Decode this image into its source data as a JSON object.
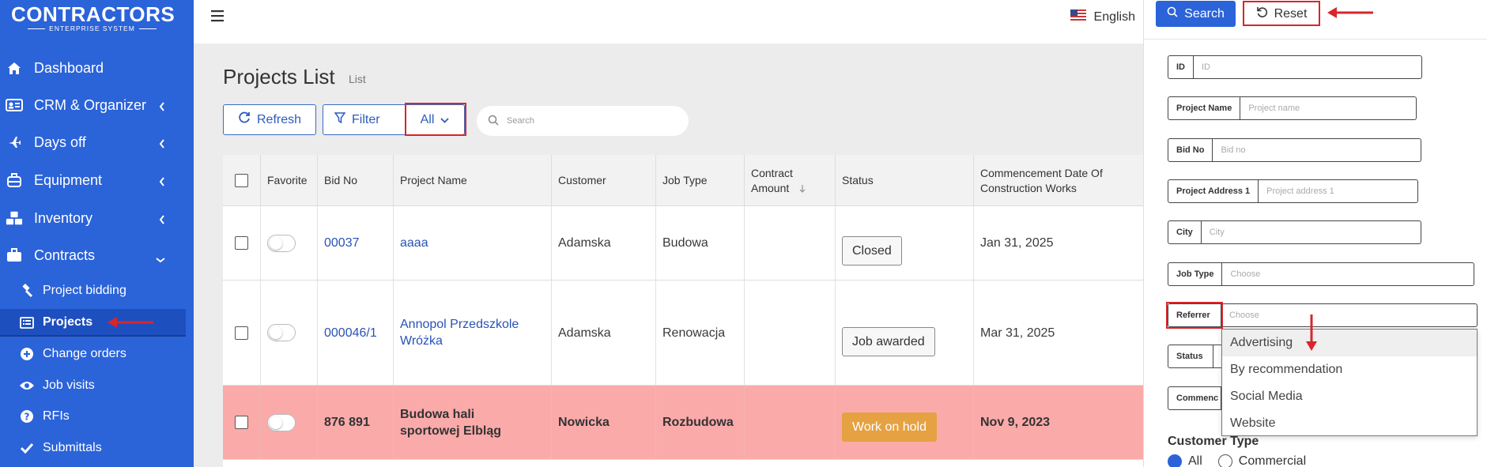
{
  "logo": {
    "main": "CONTRACTORS",
    "sub": "ENTERPRISE SYSTEM"
  },
  "sidebar": {
    "items": [
      {
        "label": "Dashboard",
        "icon": "home-icon"
      },
      {
        "label": "CRM & Organizer",
        "icon": "id-card-icon"
      },
      {
        "label": "Days off",
        "icon": "plane-icon"
      },
      {
        "label": "Equipment",
        "icon": "toolbox-icon"
      },
      {
        "label": "Inventory",
        "icon": "boxes-icon"
      },
      {
        "label": "Contracts",
        "icon": "briefcase-icon"
      }
    ],
    "subitems": [
      {
        "label": "Project bidding",
        "icon": "gavel-icon"
      },
      {
        "label": "Projects",
        "icon": "list-icon"
      },
      {
        "label": "Change orders",
        "icon": "plus-circle-icon"
      },
      {
        "label": "Job visits",
        "icon": "eye-icon"
      },
      {
        "label": "RFIs",
        "icon": "question-circle-icon"
      },
      {
        "label": "Submittals",
        "icon": "check-icon"
      }
    ]
  },
  "topbar": {
    "language": "English"
  },
  "page": {
    "title": "Projects List",
    "subtitle": "List"
  },
  "toolbar": {
    "refresh_label": "Refresh",
    "filter_label": "Filter",
    "all_label": "All",
    "search_placeholder": "Search"
  },
  "table": {
    "headers": {
      "favorite": "Favorite",
      "bid_no": "Bid No",
      "project_name": "Project Name",
      "customer": "Customer",
      "job_type": "Job Type",
      "contract_amount": "Contract Amount",
      "status": "Status",
      "commencement": "Commencement Date Of Construction Works"
    },
    "rows": [
      {
        "bid_no": "00037",
        "project_name": "aaaa",
        "customer": "Adamska",
        "job_type": "Budowa",
        "contract_amount": "",
        "status": "Closed",
        "commencement": "Jan 31, 2025"
      },
      {
        "bid_no": "000046/1",
        "project_name": "Annopol Przedszkole Wróżka",
        "customer": "Adamska",
        "job_type": "Renowacja",
        "contract_amount": "",
        "status": "Job awarded",
        "commencement": "Mar 31, 2025"
      },
      {
        "bid_no": "876 891",
        "project_name": "Budowa hali sportowej Elbląg",
        "customer": "Nowicka",
        "job_type": "Rozbudowa",
        "contract_amount": "",
        "status": "Work on hold",
        "commencement": "Nov 9, 2023"
      }
    ]
  },
  "panel": {
    "search_label": "Search",
    "reset_label": "Reset",
    "fields": {
      "id": {
        "label": "ID",
        "placeholder": "ID"
      },
      "project_name": {
        "label": "Project Name",
        "placeholder": "Project name"
      },
      "bid_no": {
        "label": "Bid No",
        "placeholder": "Bid no"
      },
      "project_address": {
        "label": "Project Address 1",
        "placeholder": "Project address 1"
      },
      "city": {
        "label": "City",
        "placeholder": "City"
      },
      "job_type": {
        "label": "Job Type",
        "placeholder": "Choose"
      },
      "referrer": {
        "label": "Referrer",
        "placeholder": "Choose"
      },
      "status": {
        "label": "Status"
      },
      "commencement": {
        "label": "Commenc"
      }
    },
    "referrer_options": [
      "Advertising",
      "By recommendation",
      "Social Media",
      "Website"
    ],
    "customer_type": {
      "label": "Customer Type",
      "options": [
        "All",
        "Commercial"
      ],
      "selected": "All"
    }
  },
  "colors": {
    "primary": "#2b63d9",
    "highlight": "#d7262d",
    "row_alert": "#fbaaaa",
    "badge_hold": "#e6a142"
  }
}
